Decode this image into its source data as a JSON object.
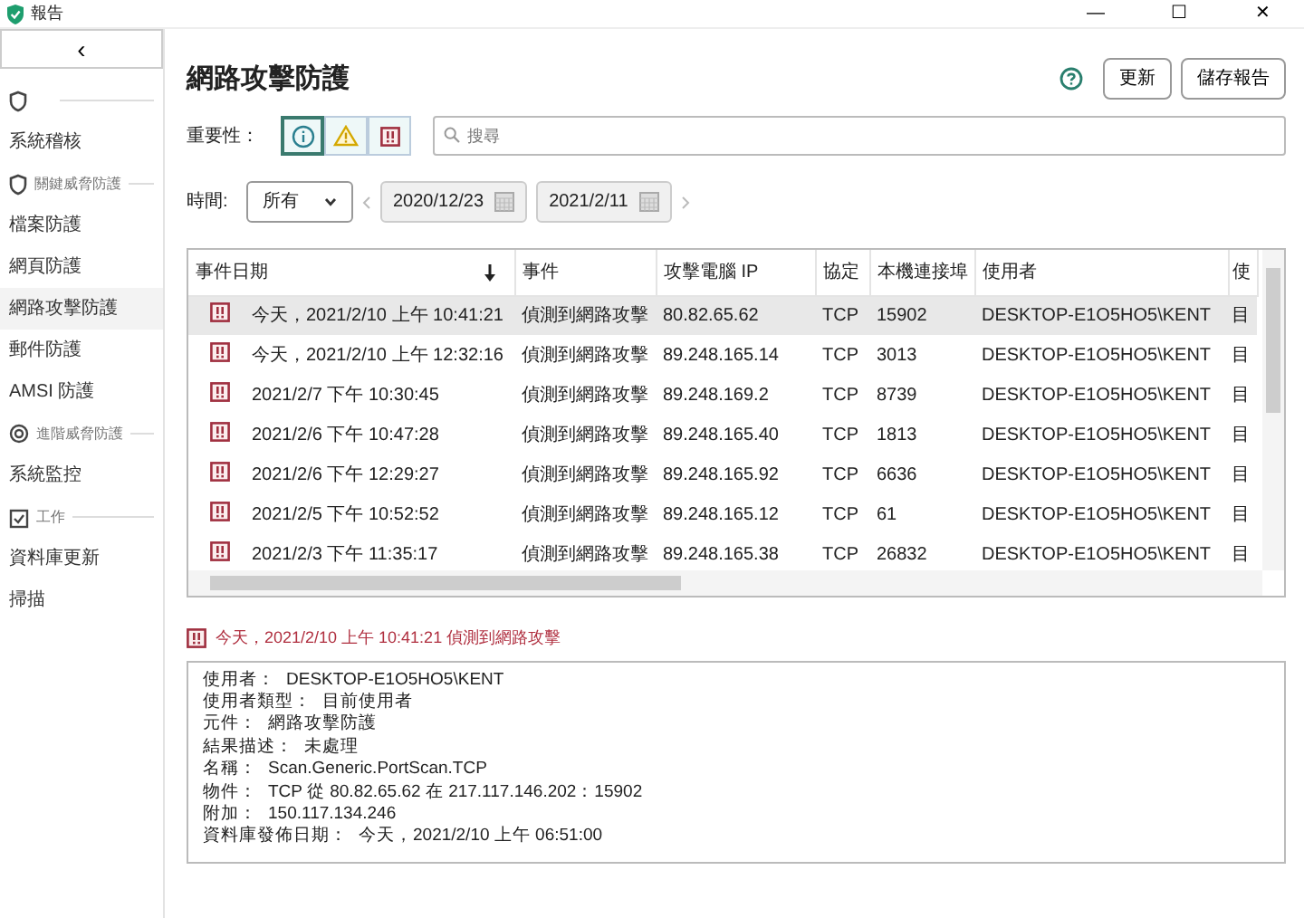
{
  "window": {
    "title": "報告",
    "controls": [
      "—",
      "☐",
      "✕"
    ]
  },
  "sidebar": {
    "collapse": "‹",
    "items": [
      {
        "kind": "section"
      },
      {
        "kind": "item",
        "label": "系統稽核",
        "selected": false
      },
      {
        "kind": "section",
        "label": "關鍵威脅防護"
      },
      {
        "kind": "item",
        "label": "檔案防護",
        "selected": false
      },
      {
        "kind": "item",
        "label": "網頁防護",
        "selected": false
      },
      {
        "kind": "item",
        "label": "網路攻擊防護",
        "selected": true
      },
      {
        "kind": "item",
        "label": "郵件防護",
        "selected": false
      },
      {
        "kind": "item",
        "label": "AMSI 防護",
        "selected": false
      },
      {
        "kind": "section",
        "label": "進階威脅防護"
      },
      {
        "kind": "item",
        "label": "系統監控",
        "selected": false
      },
      {
        "kind": "section",
        "label": "工作"
      },
      {
        "kind": "item",
        "label": "資料庫更新",
        "selected": false
      },
      {
        "kind": "item",
        "label": "掃描",
        "selected": false
      }
    ]
  },
  "page": {
    "title": "網路攻擊防護",
    "buttons": [
      "更新",
      "儲存報告"
    ]
  },
  "filters": {
    "severity_label": "重要性：",
    "severity": [
      {
        "kind": "info",
        "selected": true
      },
      {
        "kind": "warning",
        "selected": false
      },
      {
        "kind": "critical",
        "selected": false
      }
    ],
    "search": {
      "placeholder": "搜尋"
    },
    "time_label": "時間:",
    "time_value": "所有",
    "date_from": "2020/12/23",
    "date_to": "2021/2/11"
  },
  "table": {
    "columns": [
      "事件日期",
      "事件",
      "攻擊電腦 IP",
      "協定",
      "本機連接埠",
      "使用者",
      "使"
    ],
    "rows": [
      {
        "selected": true,
        "cells": [
          "今天，2021/2/10 上午 10:41:21",
          "偵測到網路攻擊",
          "80.82.65.62",
          "TCP",
          "15902",
          "DESKTOP-E1O5HO5\\KENT",
          "目"
        ]
      },
      {
        "selected": false,
        "cells": [
          "今天，2021/2/10 上午 12:32:16",
          "偵測到網路攻擊",
          "89.248.165.14",
          "TCP",
          "3013",
          "DESKTOP-E1O5HO5\\KENT",
          "目"
        ]
      },
      {
        "selected": false,
        "cells": [
          "2021/2/7 下午 10:30:45",
          "偵測到網路攻擊",
          "89.248.169.2",
          "TCP",
          "8739",
          "DESKTOP-E1O5HO5\\KENT",
          "目"
        ]
      },
      {
        "selected": false,
        "cells": [
          "2021/2/6 下午 10:47:28",
          "偵測到網路攻擊",
          "89.248.165.40",
          "TCP",
          "1813",
          "DESKTOP-E1O5HO5\\KENT",
          "目"
        ]
      },
      {
        "selected": false,
        "cells": [
          "2021/2/6 下午 12:29:27",
          "偵測到網路攻擊",
          "89.248.165.92",
          "TCP",
          "6636",
          "DESKTOP-E1O5HO5\\KENT",
          "目"
        ]
      },
      {
        "selected": false,
        "cells": [
          "2021/2/5 下午 10:52:52",
          "偵測到網路攻擊",
          "89.248.165.12",
          "TCP",
          "61",
          "DESKTOP-E1O5HO5\\KENT",
          "目"
        ]
      },
      {
        "selected": false,
        "cells": [
          "2021/2/3 下午 11:35:17",
          "偵測到網路攻擊",
          "89.248.165.38",
          "TCP",
          "26832",
          "DESKTOP-E1O5HO5\\KENT",
          "目"
        ]
      }
    ]
  },
  "detail": {
    "heading": "今天，2021/2/10 上午 10:41:21 偵測到網路攻擊",
    "lines": [
      {
        "label": "使用者：",
        "value": "DESKTOP-E1O5HO5\\KENT"
      },
      {
        "label": "使用者類型：",
        "value": "目前使用者"
      },
      {
        "label": "元件：",
        "value": "網路攻擊防護"
      },
      {
        "label": "結果描述：",
        "value": "未處理"
      },
      {
        "label": "名稱：",
        "value": "Scan.Generic.PortScan.TCP"
      },
      {
        "label": "物件：",
        "value": "TCP 從 80.82.65.62 在 217.117.146.202：15902"
      },
      {
        "label": "附加：",
        "value": "150.117.134.246"
      },
      {
        "label": "資料庫發佈日期：",
        "value": "今天，2021/2/10 上午 06:51:00"
      }
    ]
  }
}
